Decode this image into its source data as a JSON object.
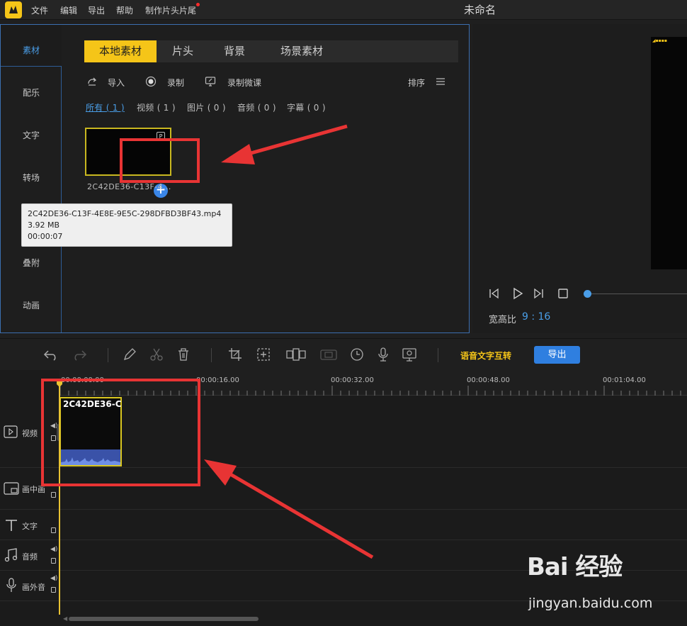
{
  "top_bar": {
    "menu": [
      "文件",
      "编辑",
      "导出",
      "帮助",
      "制作片头片尾"
    ],
    "title": "未命名"
  },
  "left_nav": [
    "素材",
    "配乐",
    "文字",
    "转场",
    "叠附",
    "动画"
  ],
  "tabs": [
    "本地素材",
    "片头",
    "背景",
    "场景素材"
  ],
  "tools": {
    "import": "导入",
    "record": "录制",
    "record_lecture": "录制微课",
    "sort": "排序"
  },
  "filters": [
    "所有 ( 1 )",
    "视频 ( 1 )",
    "图片 ( 0 )",
    "音频 ( 0 )",
    "字幕 ( 0 )"
  ],
  "media_item": {
    "name": "2C42DE36-C13F-4...",
    "badge": "P",
    "add": "+"
  },
  "tooltip": {
    "filename": "2C42DE36-C13F-4E8E-9E5C-298DFBD3BF43.mp4",
    "size": "3.92 MB",
    "duration": "00:00:07"
  },
  "preview": {
    "aspect_label": "宽高比",
    "aspect_value": "9 : 16"
  },
  "toolbar": {
    "speech_to_text": "语音文字互转",
    "export": "导出"
  },
  "timeline": {
    "ticks": [
      "00:00:00.00",
      "00:00:16.00",
      "00:00:32.00",
      "00:00:48.00",
      "00:01:04.00"
    ],
    "tracks": [
      "视频",
      "画中画",
      "文字",
      "音频",
      "画外音"
    ],
    "clip_title": "2C42DE36-C"
  },
  "watermark": {
    "brand": "Bai 经验",
    "url": "jingyan.baidu.com"
  },
  "colors": {
    "accent": "#f5c518",
    "blue": "#2f7fe0",
    "annotation": "#e83434"
  }
}
